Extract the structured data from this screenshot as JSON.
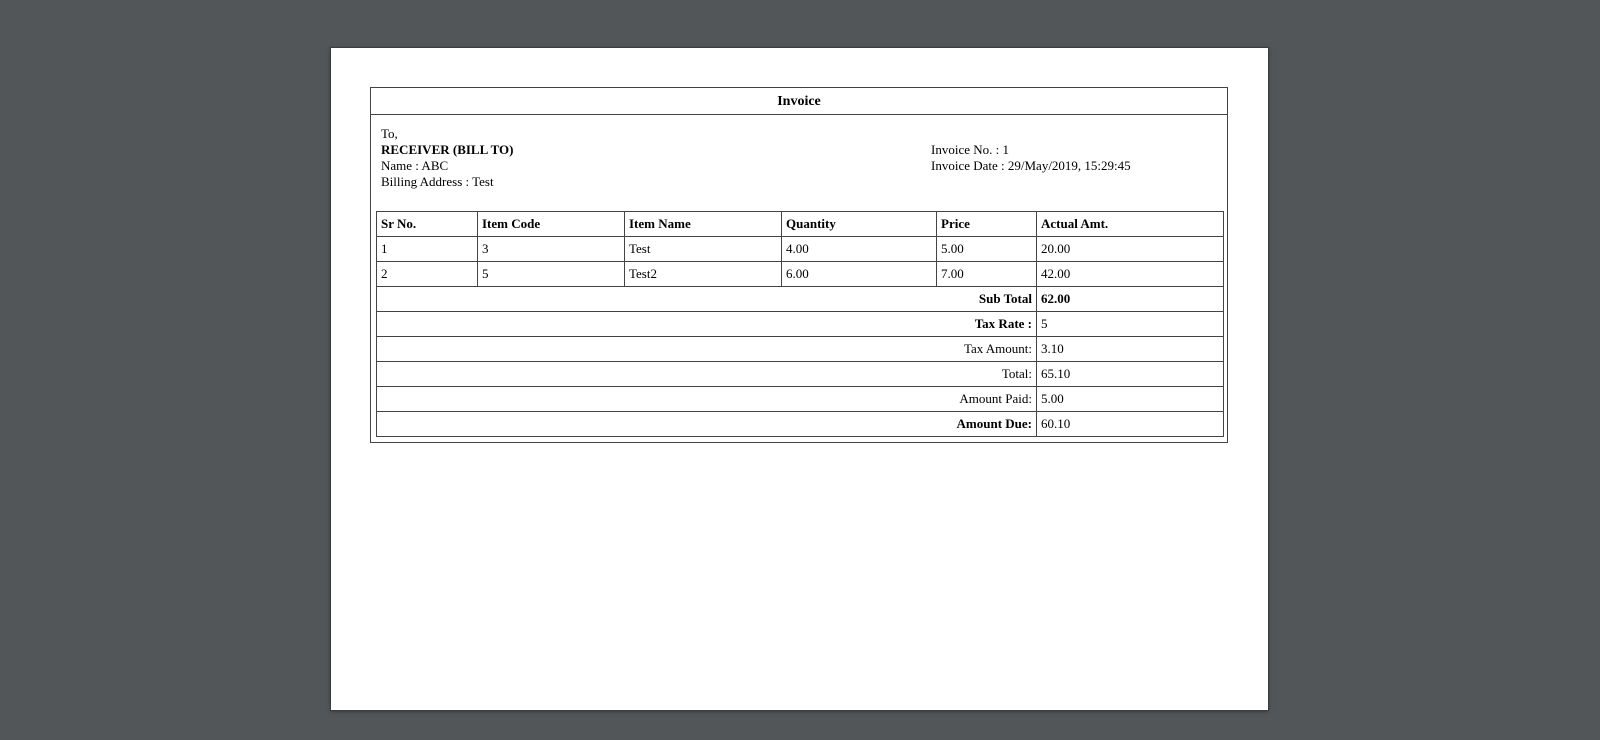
{
  "invoice": {
    "title": "Invoice",
    "to_label": "To,",
    "receiver_heading": "RECEIVER (BILL TO)",
    "name_line": "Name : ABC",
    "billing_address_line": "Billing Address : Test",
    "invoice_no_line": "Invoice No. : 1",
    "invoice_date_line": "Invoice Date : 29/May/2019, 15:29:45"
  },
  "table": {
    "headers": [
      "Sr No.",
      "Item Code",
      "Item Name",
      "Quantity",
      "Price",
      "Actual Amt."
    ],
    "rows": [
      [
        "1",
        "3",
        "Test",
        "4.00",
        "5.00",
        "20.00"
      ],
      [
        "2",
        "5",
        "Test2",
        "6.00",
        "7.00",
        "42.00"
      ]
    ],
    "summary": [
      {
        "label": "Sub Total",
        "value": "62.00"
      },
      {
        "label": "Tax Rate :",
        "value": "5"
      },
      {
        "label": "Tax Amount:",
        "value": "3.10"
      },
      {
        "label": "Total:",
        "value": "65.10"
      },
      {
        "label": "Amount Paid:",
        "value": "5.00"
      },
      {
        "label": "Amount Due:",
        "value": "60.10"
      }
    ]
  }
}
